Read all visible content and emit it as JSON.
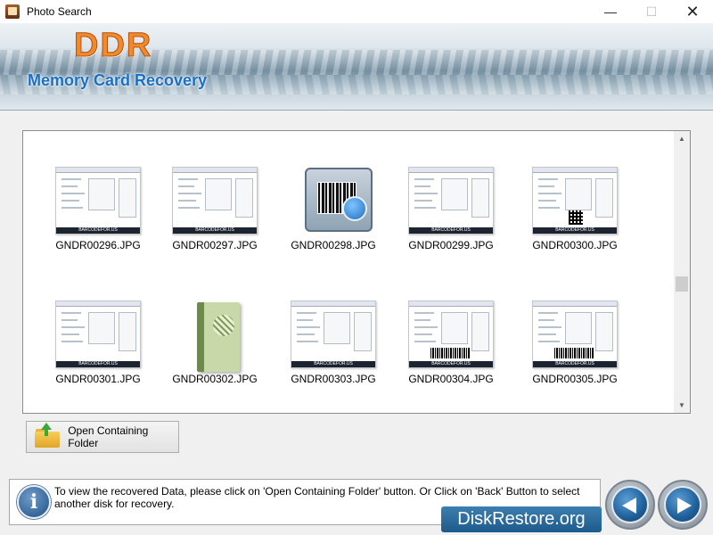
{
  "window": {
    "title": "Photo Search",
    "controls": [
      "minimize-icon",
      "maximize-icon",
      "close-icon"
    ]
  },
  "banner": {
    "logo": "DDR",
    "subtitle": "Memory Card Recovery"
  },
  "files": [
    {
      "name": "GNDR00296.JPG",
      "thumb": "screenshot"
    },
    {
      "name": "GNDR00297.JPG",
      "thumb": "screenshot"
    },
    {
      "name": "GNDR00298.JPG",
      "thumb": "barcode-app-icon"
    },
    {
      "name": "GNDR00299.JPG",
      "thumb": "screenshot"
    },
    {
      "name": "GNDR00300.JPG",
      "thumb": "screenshot-qr"
    },
    {
      "name": "GNDR00301.JPG",
      "thumb": "screenshot"
    },
    {
      "name": "GNDR00302.JPG",
      "thumb": "software-box"
    },
    {
      "name": "GNDR00303.JPG",
      "thumb": "screenshot"
    },
    {
      "name": "GNDR00304.JPG",
      "thumb": "screenshot-barcode"
    },
    {
      "name": "GNDR00305.JPG",
      "thumb": "screenshot-barcode"
    }
  ],
  "thumb_footer_text": "BARCODEFOR.US",
  "actions": {
    "open_folder_label": "Open Containing Folder"
  },
  "info": {
    "text": "To view the recovered Data, please click on 'Open Containing Folder' button. Or Click on 'Back' Button to select another disk for recovery.",
    "icon_glyph": "i"
  },
  "brand": "DiskRestore.org",
  "colors": {
    "logo": "#f08a2a",
    "subtitle": "#1a6fc6",
    "nav_button": "#1f5f99"
  }
}
